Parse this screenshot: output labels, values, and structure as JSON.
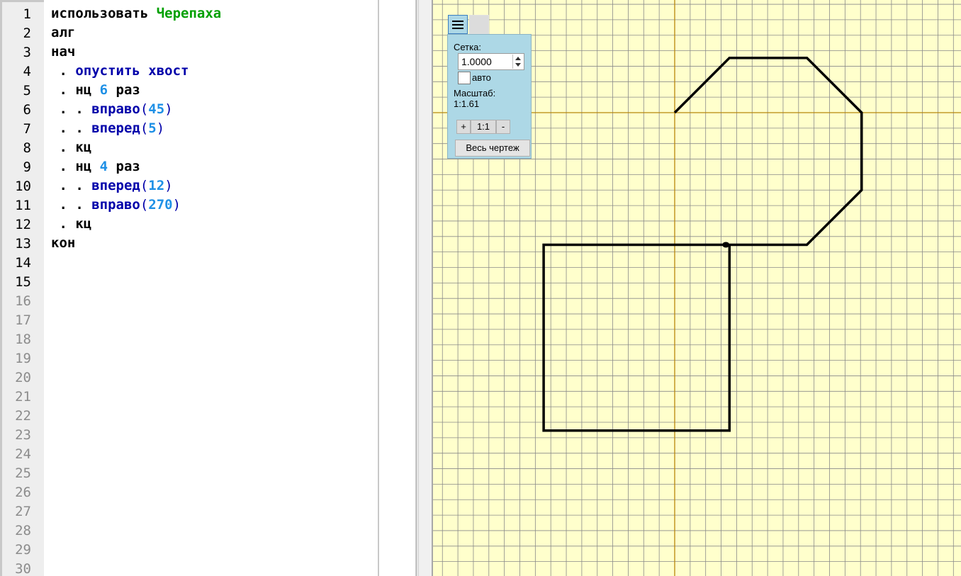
{
  "editor": {
    "line_numbers": [
      "1",
      "2",
      "3",
      "4",
      "5",
      "6",
      "7",
      "8",
      "9",
      "10",
      "11",
      "12",
      "13",
      "14",
      "15",
      "16",
      "17",
      "18",
      "19",
      "20",
      "21",
      "22",
      "23",
      "24",
      "25",
      "26",
      "27",
      "28",
      "29",
      "30"
    ],
    "used_lines": 15,
    "lines": [
      [
        {
          "t": "использовать ",
          "c": "kw"
        },
        {
          "t": "Черепаха",
          "c": "ex"
        }
      ],
      [
        {
          "t": "алг",
          "c": "kw"
        }
      ],
      [
        {
          "t": "нач",
          "c": "kw"
        }
      ],
      [
        {
          "t": " . ",
          "c": "kw"
        },
        {
          "t": "опустить хвост",
          "c": "cmd"
        }
      ],
      [
        {
          "t": " . нц ",
          "c": "kw"
        },
        {
          "t": "6",
          "c": "num"
        },
        {
          "t": " раз",
          "c": "kw"
        }
      ],
      [
        {
          "t": " . . ",
          "c": "kw"
        },
        {
          "t": "вправо",
          "c": "cmd"
        },
        {
          "t": "(",
          "c": "pn"
        },
        {
          "t": "45",
          "c": "num"
        },
        {
          "t": ")",
          "c": "pn"
        }
      ],
      [
        {
          "t": " . . ",
          "c": "kw"
        },
        {
          "t": "вперед",
          "c": "cmd"
        },
        {
          "t": "(",
          "c": "pn"
        },
        {
          "t": "5",
          "c": "num"
        },
        {
          "t": ")",
          "c": "pn"
        }
      ],
      [
        {
          "t": " . кц",
          "c": "kw"
        }
      ],
      [
        {
          "t": " . нц ",
          "c": "kw"
        },
        {
          "t": "4",
          "c": "num"
        },
        {
          "t": " раз",
          "c": "kw"
        }
      ],
      [
        {
          "t": " . . ",
          "c": "kw"
        },
        {
          "t": "вперед",
          "c": "cmd"
        },
        {
          "t": "(",
          "c": "pn"
        },
        {
          "t": "12",
          "c": "num"
        },
        {
          "t": ")",
          "c": "pn"
        }
      ],
      [
        {
          "t": " . . ",
          "c": "kw"
        },
        {
          "t": "вправо",
          "c": "cmd"
        },
        {
          "t": "(",
          "c": "pn"
        },
        {
          "t": "270",
          "c": "num"
        },
        {
          "t": ")",
          "c": "pn"
        }
      ],
      [
        {
          "t": " . кц",
          "c": "kw"
        }
      ],
      [
        {
          "t": "кон",
          "c": "kw"
        }
      ]
    ]
  },
  "drawing_panel": {
    "grid_label": "Сетка:",
    "grid_value": "1.0000",
    "auto_label": "авто",
    "auto_checked": false,
    "scale_label": "Масштаб:",
    "scale_value": "1:1.61",
    "zoom_in": "+",
    "zoom_reset": "1:1",
    "zoom_out": "-",
    "fit_button": "Весь чертеж"
  },
  "turtle_program": {
    "first_loop": {
      "repeat": 6,
      "turn": 45,
      "step": 5
    },
    "second_loop": {
      "repeat": 4,
      "step": 12,
      "turn": 270
    },
    "grid_step": 1
  },
  "colors": {
    "canvas_bg": "#ffffcc",
    "grid_line": "#8a8a8a",
    "axis_line": "#b8860b",
    "path": "#000000",
    "panel_bg": "#add8e6"
  }
}
